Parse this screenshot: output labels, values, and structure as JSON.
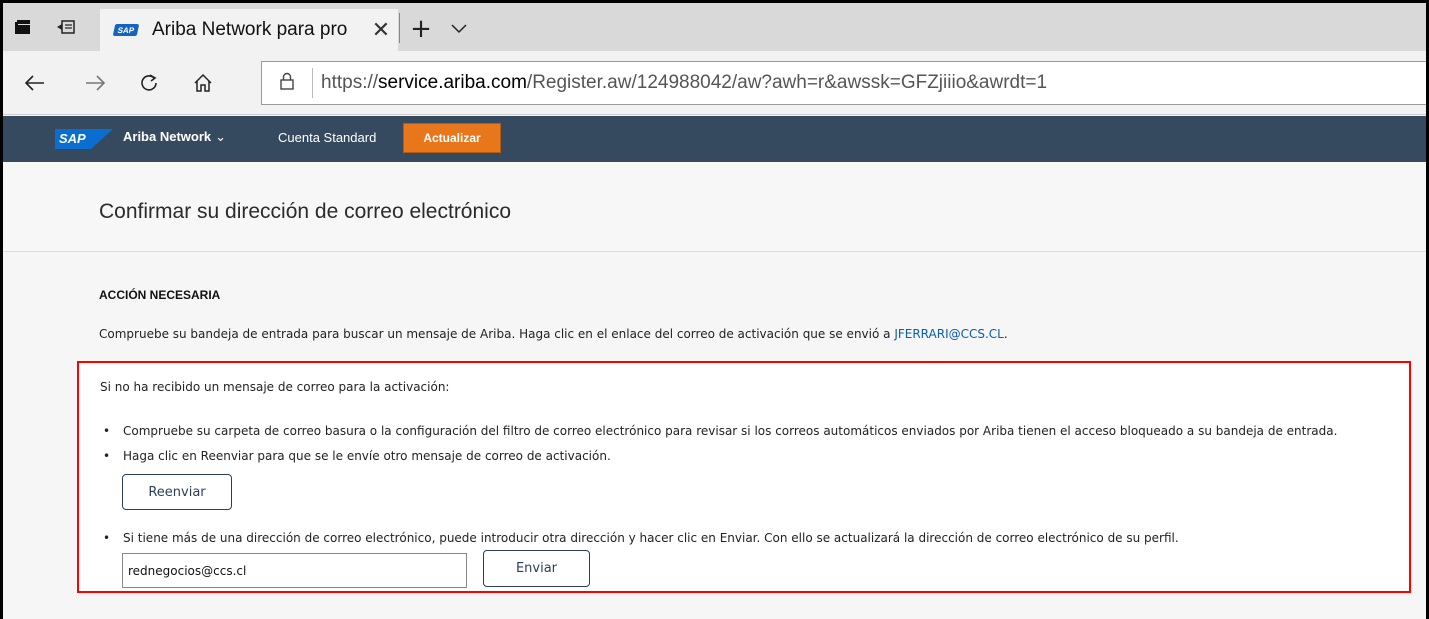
{
  "browser": {
    "tab": {
      "favicon_text": "SAP",
      "title": "Ariba Network para pro",
      "close": "✕"
    },
    "new_tab": "+",
    "tab_menu": "⌵",
    "url": {
      "scheme": "https://",
      "domain": "service.ariba.com",
      "path": "/Register.aw/124988042/aw?awh=r&awssk=GFZjiiio&awrdt=1"
    }
  },
  "header": {
    "logo": "SAP",
    "network": "Ariba Network",
    "caret": "⌄",
    "account": "Cuenta Standard",
    "upgrade": "Actualizar"
  },
  "page": {
    "title": "Confirmar su dirección de correo electrónico",
    "action_heading": "ACCIÓN NECESARIA",
    "check_text": "Compruebe su bandeja de entrada para buscar un mensaje de Ariba. Haga clic en el enlace del correo de activación que se envió a ",
    "email": "JFERRARI@CCS.CL",
    "check_text_end": "."
  },
  "box": {
    "intro": "Si no ha recibido un mensaje de correo para la activación:",
    "bullets": [
      "Compruebe su carpeta de correo basura o la configuración del filtro de correo electrónico para revisar si los correos automáticos enviados por Ariba tienen el acceso bloqueado a su bandeja de entrada.",
      "Haga clic en Reenviar para que se le envíe otro mensaje de correo de activación.",
      "Si tiene más de una dirección de correo electrónico, puede introducir otra dirección y hacer clic en Enviar. Con ello se actualizará la dirección de correo electrónico de su perfil."
    ],
    "bullet_char": "•",
    "resend_label": "Reenviar",
    "email_value": "rednegocios@ccs.cl",
    "send_label": "Enviar"
  },
  "colors": {
    "header_bg": "#354a5f",
    "upgrade_bg": "#e8771b",
    "highlight_border": "#ff0000",
    "link": "#0a5db0"
  }
}
